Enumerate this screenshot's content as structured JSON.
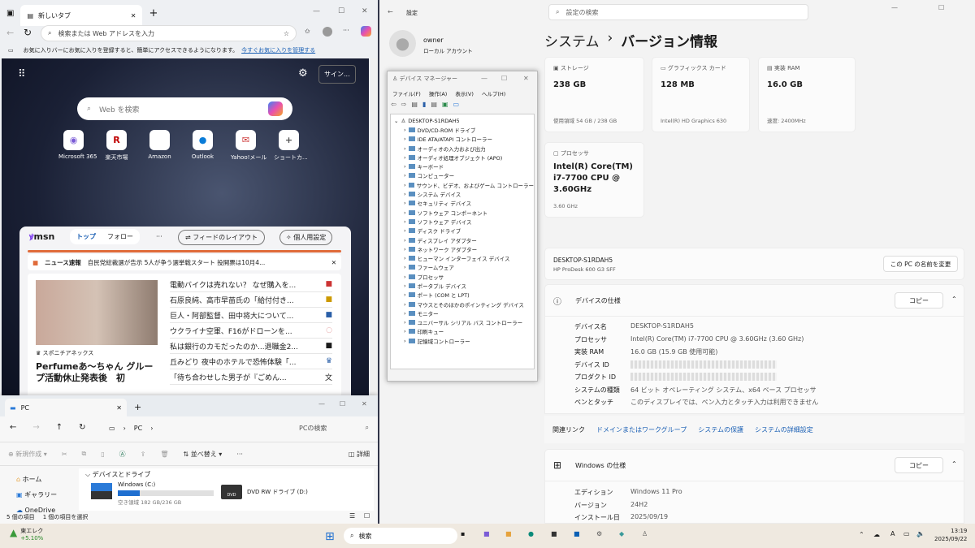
{
  "edge": {
    "tab_title": "新しいタブ",
    "address_placeholder": "検索または Web アドレスを入力",
    "favbar_text": "お気に入りバーにお気に入りを登録すると、簡単にアクセスできるようになります。",
    "favbar_link": "今すぐお気に入りを管理する",
    "signin": "サイン...",
    "web_search_placeholder": "Web を検索",
    "tiles": [
      "Microsoft 365",
      "楽天市場",
      "Amazon",
      "Outlook",
      "Yahoo!メール",
      "ショートカ..."
    ],
    "msn": {
      "logo": "msn",
      "tabs": [
        "トップ",
        "フォロー"
      ],
      "more": "···",
      "layout_btn": "フィードのレイアウト",
      "personalize_btn": "個人用設定",
      "breaking_label": "ニュース速報",
      "breaking_text": "自民党総裁選が告示 5人が争う選挙戦スタート 投開票は10月4...",
      "source": "スポニチアネックス",
      "headline": "Perfumeあ～ちゃん グループ活動休止発表後　初",
      "news": [
        "電動バイクは売れない？ なぜ購入を...",
        "石原良純、高市早苗氏の「給付付き...",
        "巨人・阿部監督、田中将大について...",
        "ウクライナ空軍、F16がドローンを...",
        "私は銀行のカモだったのか...退職金2...",
        "丘みどり 夜中のホテルで恐怖体験「...",
        "「待ち合わせした男子が『ごめん..."
      ]
    }
  },
  "settings": {
    "app_title": "設定",
    "search_placeholder": "設定の検索",
    "user": "owner",
    "account": "ローカル アカウント",
    "breadcrumb_parent": "システム",
    "breadcrumb_sep": "›",
    "page_title": "バージョン情報",
    "cards": [
      {
        "label": "ストレージ",
        "value": "238 GB",
        "sub": "使用領域 54 GB / 238 GB"
      },
      {
        "label": "グラフィックス カード",
        "value": "128 MB",
        "sub": "Intel(R) HD Graphics 630"
      },
      {
        "label": "実装 RAM",
        "value": "16.0 GB",
        "sub": "速度: 2400MHz"
      },
      {
        "label": "プロセッサ",
        "value": "Intel(R) Core(TM) i7-7700 CPU @ 3.60GHz",
        "sub": "3.60 GHz"
      }
    ],
    "device_name": "DESKTOP-S1RDAH5",
    "model": "HP ProDesk 600 G3 SFF",
    "rename_btn": "この PC の名前を変更",
    "device_spec_title": "デバイスの仕様",
    "copy": "コピー",
    "device_spec": [
      {
        "k": "デバイス名",
        "v": "DESKTOP-S1RDAH5"
      },
      {
        "k": "プロセッサ",
        "v": "Intel(R) Core(TM) i7-7700 CPU @ 3.60GHz (3.60 GHz)"
      },
      {
        "k": "実装 RAM",
        "v": "16.0 GB (15.9 GB 使用可能)"
      },
      {
        "k": "デバイス ID",
        "v": ""
      },
      {
        "k": "プロダクト ID",
        "v": ""
      },
      {
        "k": "システムの種類",
        "v": "64 ビット オペレーティング システム、x64 ベース プロセッサ"
      },
      {
        "k": "ペンとタッチ",
        "v": "このディスプレイでは、ペン入力とタッチ入力は利用できません"
      }
    ],
    "related_label": "関連リンク",
    "related_links": [
      "ドメインまたはワークグループ",
      "システムの保護",
      "システムの詳細設定"
    ],
    "windows_spec_title": "Windows の仕様",
    "windows_spec": [
      {
        "k": "エディション",
        "v": "Windows 11 Pro"
      },
      {
        "k": "バージョン",
        "v": "24H2"
      },
      {
        "k": "インストール日",
        "v": "2025/09/19"
      }
    ]
  },
  "devmgr": {
    "title": "デバイス マネージャー",
    "menu": [
      "ファイル(F)",
      "操作(A)",
      "表示(V)",
      "ヘルプ(H)"
    ],
    "root": "DESKTOP-S1RDAH5",
    "nodes": [
      "DVD/CD-ROM ドライブ",
      "IDE ATA/ATAPI コントローラー",
      "オーディオの入力および出力",
      "オーディオ処理オブジェクト (APO)",
      "キーボード",
      "コンピューター",
      "サウンド、ビデオ、およびゲーム コントローラー",
      "システム デバイス",
      "セキュリティ デバイス",
      "ソフトウェア コンポーネント",
      "ソフトウェア デバイス",
      "ディスク ドライブ",
      "ディスプレイ アダプター",
      "ネットワーク アダプター",
      "ヒューマン インターフェイス デバイス",
      "ファームウェア",
      "プロセッサ",
      "ポータブル デバイス",
      "ポート (COM と LPT)",
      "マウスとそのほかのポインティング デバイス",
      "モニター",
      "ユニバーサル シリアル バス コントローラー",
      "印刷キュー",
      "記憶域コントローラー"
    ]
  },
  "explorer": {
    "tab": "PC",
    "crumb": "PC",
    "search_placeholder": "PCの検索",
    "new": "新規作成",
    "sort": "並べ替え",
    "details": "詳細",
    "nav": [
      "ホーム",
      "ギャラリー",
      "OneDrive"
    ],
    "group": "デバイスとドライブ",
    "drives": [
      {
        "name": "Windows (C:)",
        "free": "空き領域 182 GB/236 GB",
        "used_fraction": 0.23
      },
      {
        "name": "DVD RW ドライブ (D:)"
      }
    ],
    "status_items": "5 個の項目",
    "status_selected": "1 個の項目を選択"
  },
  "taskbar": {
    "stock_name": "東エレク",
    "stock_change": "+5.10%",
    "search": "検索",
    "time": "13:19",
    "date": "2025/09/22",
    "ime": "A"
  }
}
